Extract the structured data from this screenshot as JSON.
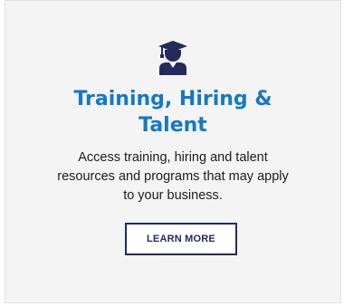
{
  "card": {
    "icon": "graduate-icon",
    "title_line1": "Training, Hiring &",
    "title_line2": "Talent",
    "description_line1": "Access training, hiring and talent",
    "description_line2": "resources and programs that may apply",
    "description_line3": "to your business.",
    "button_label": "LEARN MORE"
  },
  "colors": {
    "title": "#1479c6",
    "icon": "#25295c",
    "button_border": "#25295c",
    "card_background": "#f4f4f4"
  }
}
